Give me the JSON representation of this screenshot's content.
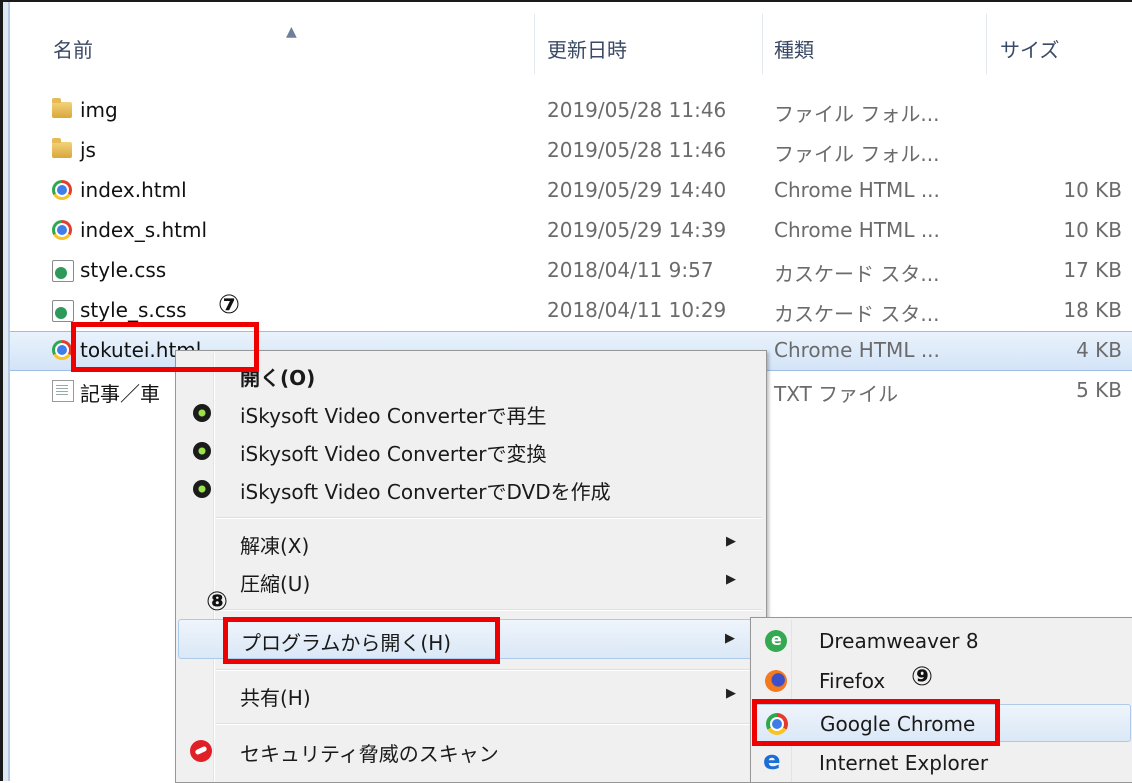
{
  "columns": {
    "name": "名前",
    "date": "更新日時",
    "type": "種類",
    "size": "サイズ",
    "sort_indicator": "▲"
  },
  "files": [
    {
      "name": "img",
      "date": "2019/05/28 11:46",
      "type": "ファイル フォル...",
      "size": "",
      "icon": "folder-icon"
    },
    {
      "name": "js",
      "date": "2019/05/28 11:46",
      "type": "ファイル フォル...",
      "size": "",
      "icon": "folder-icon"
    },
    {
      "name": "index.html",
      "date": "2019/05/29 14:40",
      "type": "Chrome HTML ...",
      "size": "10 KB",
      "icon": "chrome-icon"
    },
    {
      "name": "index_s.html",
      "date": "2019/05/29 14:39",
      "type": "Chrome HTML ...",
      "size": "10 KB",
      "icon": "chrome-icon"
    },
    {
      "name": "style.css",
      "date": "2018/04/11 9:57",
      "type": "カスケード スタ...",
      "size": "17 KB",
      "icon": "css-file-icon"
    },
    {
      "name": "style_s.css",
      "date": "2018/04/11 10:29",
      "type": "カスケード スタ...",
      "size": "18 KB",
      "icon": "css-file-icon"
    },
    {
      "name": "tokutei.html",
      "date": "",
      "type": "Chrome HTML ...",
      "size": "4 KB",
      "icon": "chrome-icon",
      "selected": true
    },
    {
      "name": "記事／車",
      "date": "",
      "type": "TXT ファイル",
      "size": "5 KB",
      "icon": "text-file-icon"
    }
  ],
  "context_menu": {
    "open": "開く(O)",
    "iskysoft_play": "iSkysoft Video Converterで再生",
    "iskysoft_convert": "iSkysoft Video Converterで変換",
    "iskysoft_dvd": "iSkysoft Video ConverterでDVDを作成",
    "extract": "解凍(X)",
    "compress": "圧縮(U)",
    "open_with": "プログラムから開く(H)",
    "share": "共有(H)",
    "security_scan": "セキュリティ脅威のスキャン",
    "submenu_arrow": "▶"
  },
  "open_with_submenu": {
    "dreamweaver": "Dreamweaver 8",
    "firefox": "Firefox",
    "chrome": "Google Chrome",
    "ie": "Internet Explorer"
  },
  "annotations": {
    "step7": "⑦",
    "step8": "⑧",
    "step9": "⑨"
  },
  "colors": {
    "highlight_red": "#ee0000",
    "selection_blue": "#d3e4f7"
  }
}
